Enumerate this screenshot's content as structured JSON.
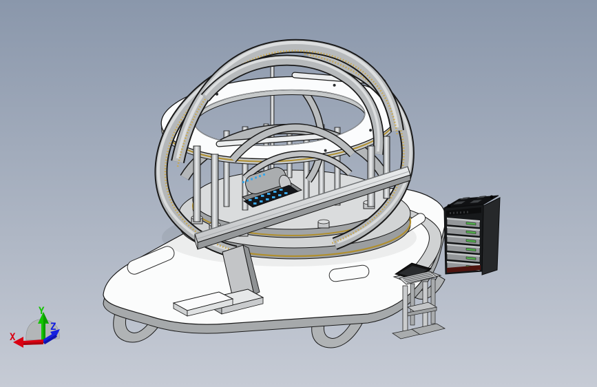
{
  "viewport": {
    "type": "cad-3d-viewport",
    "background_top": "#8a97ab",
    "background_bottom": "#c6cbd5"
  },
  "triad": {
    "axes": [
      {
        "id": "x",
        "label": "X",
        "color": "#d90012"
      },
      {
        "id": "y",
        "label": "Y",
        "color": "#12c400"
      },
      {
        "id": "z",
        "label": "Z",
        "color": "#1420e0"
      }
    ]
  },
  "model": {
    "assembly": "gimbal-gyroscope-assembly",
    "palette": {
      "part_white": "#fbfcfc",
      "part_light": "#d7d9da",
      "part_mid": "#b4b7b9",
      "part_dark": "#8f9294",
      "edge": "#161616",
      "brass_band": "#b08f2e",
      "rack_gold": "#c9a84e",
      "accent_blue": "#38a7e8"
    },
    "tower": {
      "drawer_count": 6,
      "frame": "#17191b",
      "side": "#26282a",
      "top": "#101113",
      "drawer_face": "#94979a",
      "drawer_highlight": "#c2c5c7",
      "drawer_label": "#56b44e",
      "base_stripe": "#4e130e",
      "port": "#3f4245"
    }
  }
}
